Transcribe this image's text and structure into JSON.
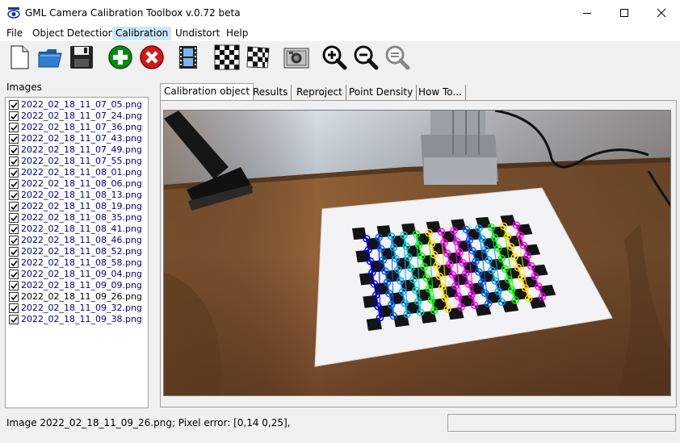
{
  "window": {
    "title": "GML Camera Calibration Toolbox  v.0.72 beta",
    "controls": [
      "minimize-icon",
      "maximize-icon",
      "close-icon"
    ]
  },
  "menu": {
    "items": [
      "File",
      "Object Detection",
      "Calibration",
      "Undistort",
      "Help"
    ],
    "active": "Calibration"
  },
  "toolbar": {
    "buttons": [
      "new-file-icon",
      "open-folder-icon",
      "save-icon",
      "add-icon",
      "remove-icon",
      "film-icon",
      "checkerboard-icon",
      "checkerboard-distorted-icon",
      "camera-icon",
      "zoom-in-icon",
      "zoom-out-icon",
      "zoom-reset-icon"
    ]
  },
  "images": {
    "label": "Images",
    "files": [
      {
        "name": "2022_02_18_11_07_05.png",
        "checked": true
      },
      {
        "name": "2022_02_18_11_07_24.png",
        "checked": true
      },
      {
        "name": "2022_02_18_11_07_36.png",
        "checked": true
      },
      {
        "name": "2022_02_18_11_07_43.png",
        "checked": true
      },
      {
        "name": "2022_02_18_11_07_49.png",
        "checked": true
      },
      {
        "name": "2022_02_18_11_07_55.png",
        "checked": true
      },
      {
        "name": "2022_02_18_11_08_01.png",
        "checked": true
      },
      {
        "name": "2022_02_18_11_08_06.png",
        "checked": true
      },
      {
        "name": "2022_02_18_11_08_13.png",
        "checked": true
      },
      {
        "name": "2022_02_18_11_08_19.png",
        "checked": true
      },
      {
        "name": "2022_02_18_11_08_35.png",
        "checked": true
      },
      {
        "name": "2022_02_18_11_08_41.png",
        "checked": true
      },
      {
        "name": "2022_02_18_11_08_46.png",
        "checked": true
      },
      {
        "name": "2022_02_18_11_08_52.png",
        "checked": true
      },
      {
        "name": "2022_02_18_11_08_58.png",
        "checked": true
      },
      {
        "name": "2022_02_18_11_09_04.png",
        "checked": true
      },
      {
        "name": "2022_02_18_11_09_09.png",
        "checked": true
      },
      {
        "name": "2022_02_18_11_09_26.png",
        "checked": true,
        "selected": true
      },
      {
        "name": "2022_02_18_11_09_32.png",
        "checked": true
      },
      {
        "name": "2022_02_18_11_09_38.png",
        "checked": true
      }
    ]
  },
  "tabs": {
    "items": [
      "Calibration object",
      "Results",
      "Reproject",
      "Point Density",
      "How To..."
    ],
    "active": "Calibration object"
  },
  "calibration_view": {
    "grid_columns": 13,
    "grid_rows": 8,
    "series_colors": [
      "#0000ff",
      "#0066ff",
      "#00aaff",
      "#00cccc",
      "#00ff00",
      "#ffdd00",
      "#ff00ff",
      "#ff00ff",
      "#0066ff",
      "#00aaff",
      "#00ff00",
      "#ffdd00",
      "#ff00ff"
    ]
  },
  "status": {
    "text": "Image 2022_02_18_11_09_26.png; Pixel error: [0,14  0,25],",
    "right_box": ""
  }
}
